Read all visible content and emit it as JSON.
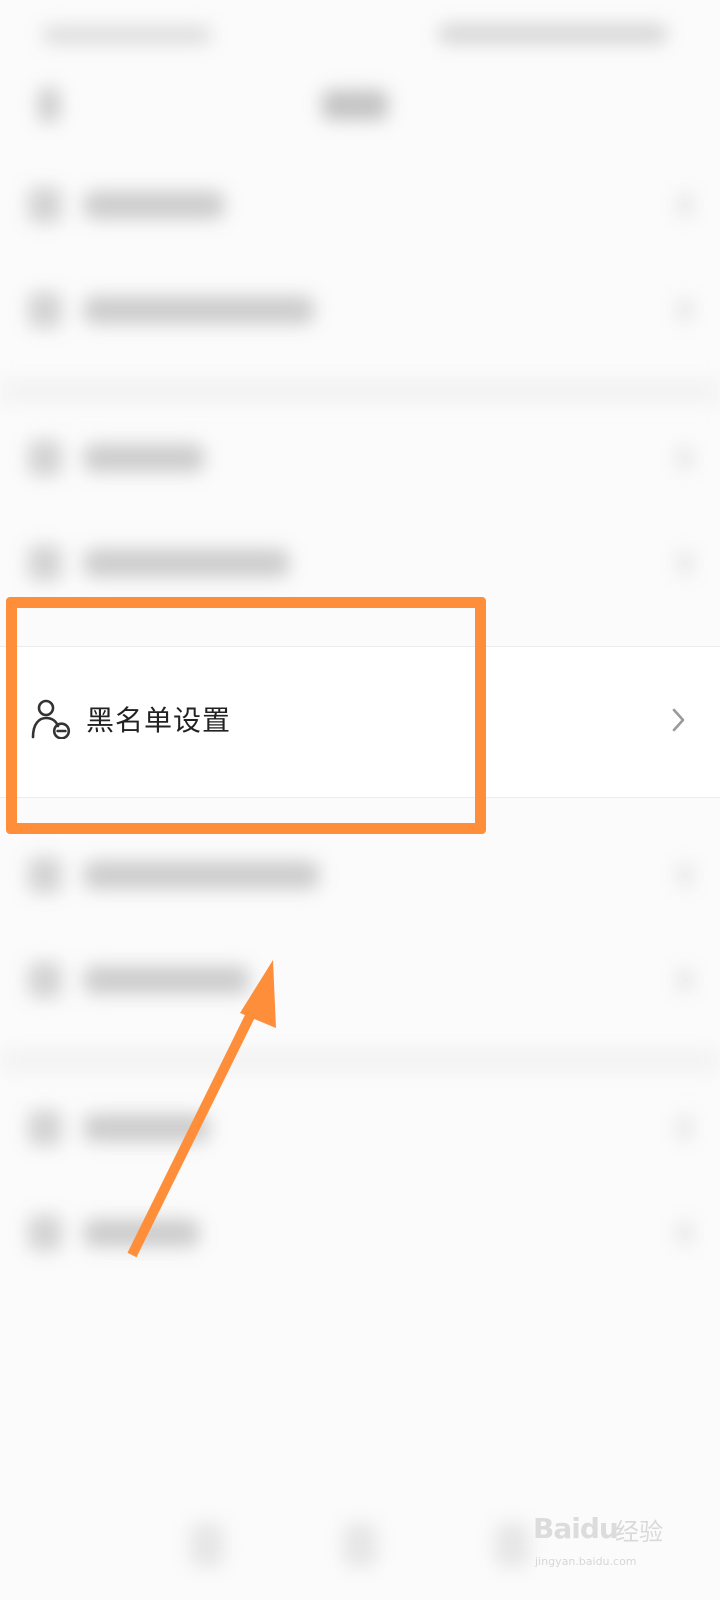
{
  "highlighted_row": {
    "label": "黑名单设置",
    "icon": "user-minus-icon",
    "trailing_icon": "chevron-right-icon"
  },
  "annotation": {
    "color": "#ff8e3a"
  },
  "watermark": {
    "brand": "Baidu",
    "word": "经验",
    "domain": "jingyan.baidu.com"
  },
  "colors": {
    "background": "#fbfbfb",
    "row_background": "#ffffff",
    "text": "#222222",
    "chevron": "#9a9a9a"
  }
}
